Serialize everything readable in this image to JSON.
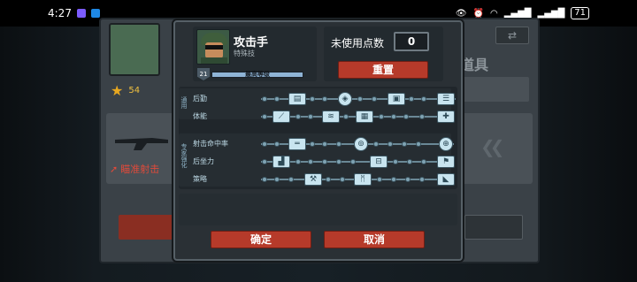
{
  "status_bar": {
    "time": "4:27",
    "battery": "71",
    "app_icon_colors": [
      "#7c5cff",
      "#1e88e5"
    ]
  },
  "background": {
    "rank_value": "54",
    "skill_label": "瞄准射击",
    "tools_label": "道具"
  },
  "dialog": {
    "class_name": "攻击手",
    "class_subtitle": "特殊技",
    "level": "21",
    "level_bar_text": "最高等级",
    "level_progress": 1.0,
    "points_label": "未使用点数",
    "points_value": "0",
    "reset_label": "重置",
    "categories": [
      {
        "label": "通用",
        "rows": [
          "后勤",
          "体能"
        ]
      },
      {
        "label": "专家强化",
        "rows": [
          "射击命中率",
          "后坐力",
          "策略"
        ]
      }
    ],
    "confirm_label": "确定",
    "cancel_label": "取消"
  },
  "colors": {
    "accent_red": "#b63a2a",
    "skill_fill": "#c8e4ef",
    "track": "#6a8896"
  }
}
